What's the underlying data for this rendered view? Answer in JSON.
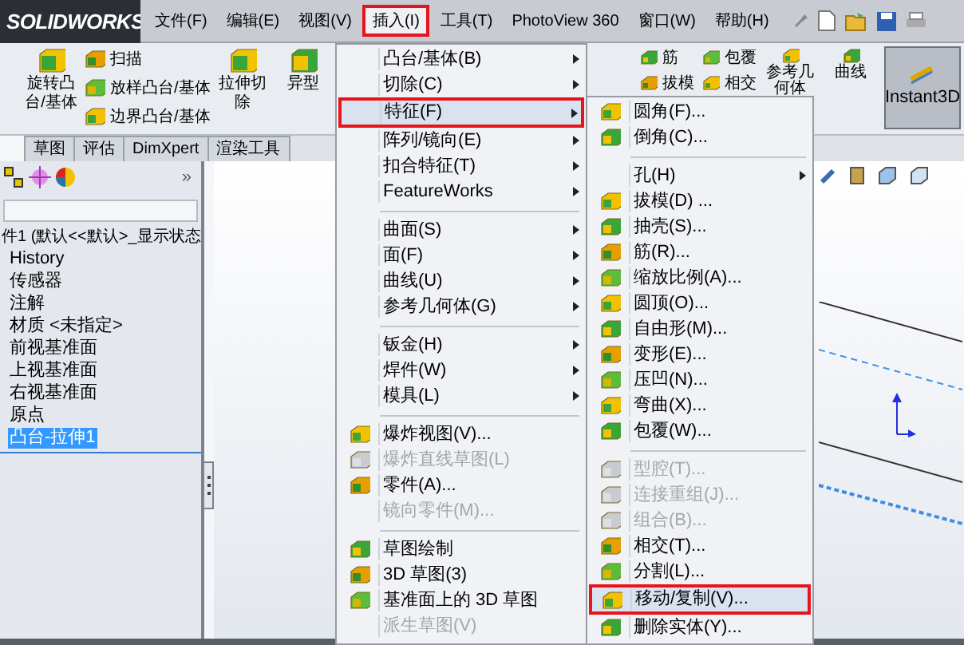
{
  "logo": {
    "text": "SOLIDWORKS"
  },
  "menubar": [
    {
      "label": "文件(F)",
      "selected": false
    },
    {
      "label": "编辑(E)",
      "selected": false
    },
    {
      "label": "视图(V)",
      "selected": false
    },
    {
      "label": "插入(I)",
      "selected": true,
      "annotated": true
    },
    {
      "label": "工具(T)",
      "selected": false
    },
    {
      "label": "PhotoView 360",
      "selected": false
    },
    {
      "label": "窗口(W)",
      "selected": false
    },
    {
      "label": "帮助(H)",
      "selected": false
    }
  ],
  "ribbon_left": [
    {
      "label": "旋转凸台/基体",
      "kind": "large"
    },
    {
      "label": "扫描",
      "kind": "small"
    },
    {
      "label": "放样凸台/基体",
      "kind": "small"
    },
    {
      "label": "边界凸台/基体",
      "kind": "small"
    },
    {
      "label": "拉伸切除",
      "kind": "large"
    },
    {
      "label": "异型",
      "kind": "large"
    }
  ],
  "ribbon_right": [
    {
      "label": "筋",
      "kind": "small"
    },
    {
      "label": "拔模",
      "kind": "small"
    },
    {
      "label": "包覆",
      "kind": "small"
    },
    {
      "label": "相交",
      "kind": "small"
    },
    {
      "label": "参考几何体",
      "kind": "large"
    },
    {
      "label": "曲线",
      "kind": "large"
    },
    {
      "label": "Instant3D",
      "kind": "toggle",
      "on": true
    }
  ],
  "tabs": [
    {
      "label": "草图",
      "selected": false
    },
    {
      "label": "评估",
      "selected": false
    },
    {
      "label": "DimXpert",
      "selected": false
    },
    {
      "label": "渲染工具",
      "selected": false
    }
  ],
  "panel_chevron": "»",
  "tree": [
    {
      "label": "件1 (默认<<默认>_显示状态",
      "selected": false
    },
    {
      "label": "History",
      "selected": false
    },
    {
      "label": "传感器",
      "selected": false
    },
    {
      "label": "注解",
      "selected": false
    },
    {
      "label": "材质 <未指定>",
      "selected": false
    },
    {
      "label": "前视基准面",
      "selected": false
    },
    {
      "label": "上视基准面",
      "selected": false
    },
    {
      "label": "右视基准面",
      "selected": false
    },
    {
      "label": "原点",
      "selected": false
    },
    {
      "label": "凸台-拉伸1",
      "selected": true
    }
  ],
  "insert_menu": [
    {
      "kind": "item",
      "label": "凸台/基体(B)",
      "submenu": true,
      "icon": false,
      "disabled": false,
      "selected": false
    },
    {
      "kind": "item",
      "label": "切除(C)",
      "submenu": true,
      "icon": false,
      "disabled": false,
      "selected": false
    },
    {
      "kind": "item",
      "label": "特征(F)",
      "submenu": true,
      "icon": false,
      "disabled": false,
      "selected": true,
      "annotated": true
    },
    {
      "kind": "item",
      "label": "阵列/镜向(E)",
      "submenu": true,
      "icon": false,
      "disabled": false,
      "selected": false
    },
    {
      "kind": "item",
      "label": "扣合特征(T)",
      "submenu": true,
      "icon": false,
      "disabled": false,
      "selected": false
    },
    {
      "kind": "item",
      "label": "FeatureWorks",
      "submenu": true,
      "icon": false,
      "disabled": false,
      "selected": false
    },
    {
      "kind": "separator"
    },
    {
      "kind": "item",
      "label": "曲面(S)",
      "submenu": true,
      "icon": false,
      "disabled": false,
      "selected": false
    },
    {
      "kind": "item",
      "label": "面(F)",
      "submenu": true,
      "icon": false,
      "disabled": false,
      "selected": false
    },
    {
      "kind": "item",
      "label": "曲线(U)",
      "submenu": true,
      "icon": false,
      "disabled": false,
      "selected": false
    },
    {
      "kind": "item",
      "label": "参考几何体(G)",
      "submenu": true,
      "icon": false,
      "disabled": false,
      "selected": false
    },
    {
      "kind": "separator"
    },
    {
      "kind": "item",
      "label": "钣金(H)",
      "submenu": true,
      "icon": false,
      "disabled": false,
      "selected": false
    },
    {
      "kind": "item",
      "label": "焊件(W)",
      "submenu": true,
      "icon": false,
      "disabled": false,
      "selected": false
    },
    {
      "kind": "item",
      "label": "模具(L)",
      "submenu": true,
      "icon": false,
      "disabled": false,
      "selected": false
    },
    {
      "kind": "separator"
    },
    {
      "kind": "item",
      "label": "爆炸视图(V)...",
      "submenu": false,
      "icon": true,
      "disabled": false,
      "selected": false
    },
    {
      "kind": "item",
      "label": "爆炸直线草图(L)",
      "submenu": false,
      "icon": true,
      "disabled": true,
      "selected": false
    },
    {
      "kind": "item",
      "label": "零件(A)...",
      "submenu": false,
      "icon": true,
      "disabled": false,
      "selected": false
    },
    {
      "kind": "item",
      "label": "镜向零件(M)...",
      "submenu": false,
      "icon": false,
      "disabled": true,
      "selected": false
    },
    {
      "kind": "separator"
    },
    {
      "kind": "item",
      "label": "草图绘制",
      "submenu": false,
      "icon": true,
      "disabled": false,
      "selected": false
    },
    {
      "kind": "item",
      "label": "3D 草图(3)",
      "submenu": false,
      "icon": true,
      "disabled": false,
      "selected": false
    },
    {
      "kind": "item",
      "label": "基准面上的 3D 草图",
      "submenu": false,
      "icon": true,
      "disabled": false,
      "selected": false
    },
    {
      "kind": "item",
      "label": "派生草图(V)",
      "submenu": false,
      "icon": false,
      "disabled": true,
      "selected": false
    }
  ],
  "feature_menu": [
    {
      "kind": "item",
      "label": "圆角(F)...",
      "submenu": false,
      "icon": true,
      "disabled": false,
      "selected": false
    },
    {
      "kind": "item",
      "label": "倒角(C)...",
      "submenu": false,
      "icon": true,
      "disabled": false,
      "selected": false
    },
    {
      "kind": "separator"
    },
    {
      "kind": "item",
      "label": "孔(H)",
      "submenu": true,
      "icon": false,
      "disabled": false,
      "selected": false
    },
    {
      "kind": "item",
      "label": "拔模(D) ...",
      "submenu": false,
      "icon": true,
      "disabled": false,
      "selected": false
    },
    {
      "kind": "item",
      "label": "抽壳(S)...",
      "submenu": false,
      "icon": true,
      "disabled": false,
      "selected": false
    },
    {
      "kind": "item",
      "label": "筋(R)...",
      "submenu": false,
      "icon": true,
      "disabled": false,
      "selected": false
    },
    {
      "kind": "item",
      "label": "缩放比例(A)...",
      "submenu": false,
      "icon": true,
      "disabled": false,
      "selected": false
    },
    {
      "kind": "item",
      "label": "圆顶(O)...",
      "submenu": false,
      "icon": true,
      "disabled": false,
      "selected": false
    },
    {
      "kind": "item",
      "label": "自由形(M)...",
      "submenu": false,
      "icon": true,
      "disabled": false,
      "selected": false
    },
    {
      "kind": "item",
      "label": "变形(E)...",
      "submenu": false,
      "icon": true,
      "disabled": false,
      "selected": false
    },
    {
      "kind": "item",
      "label": "压凹(N)...",
      "submenu": false,
      "icon": true,
      "disabled": false,
      "selected": false
    },
    {
      "kind": "item",
      "label": "弯曲(X)...",
      "submenu": false,
      "icon": true,
      "disabled": false,
      "selected": false
    },
    {
      "kind": "item",
      "label": "包覆(W)...",
      "submenu": false,
      "icon": true,
      "disabled": false,
      "selected": false
    },
    {
      "kind": "separator"
    },
    {
      "kind": "item",
      "label": "型腔(T)...",
      "submenu": false,
      "icon": true,
      "disabled": true,
      "selected": false
    },
    {
      "kind": "item",
      "label": "连接重组(J)...",
      "submenu": false,
      "icon": true,
      "disabled": true,
      "selected": false
    },
    {
      "kind": "item",
      "label": "组合(B)...",
      "submenu": false,
      "icon": true,
      "disabled": true,
      "selected": false
    },
    {
      "kind": "item",
      "label": "相交(T)...",
      "submenu": false,
      "icon": true,
      "disabled": false,
      "selected": false
    },
    {
      "kind": "item",
      "label": "分割(L)...",
      "submenu": false,
      "icon": true,
      "disabled": false,
      "selected": false
    },
    {
      "kind": "item",
      "label": "移动/复制(V)...",
      "submenu": false,
      "icon": true,
      "disabled": false,
      "selected": true,
      "annotated": true
    },
    {
      "kind": "item",
      "label": "删除实体(Y)...",
      "submenu": false,
      "icon": true,
      "disabled": false,
      "selected": false
    }
  ]
}
